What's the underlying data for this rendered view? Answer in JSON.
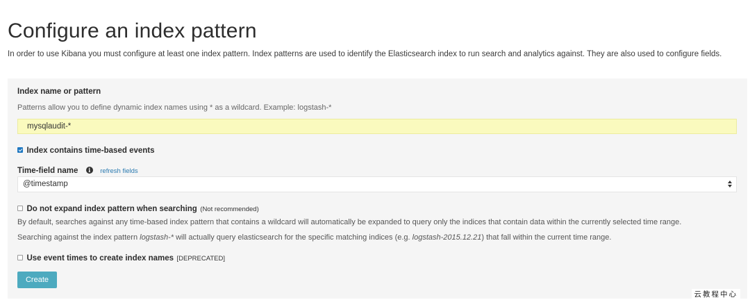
{
  "header": {
    "title": "Configure an index pattern",
    "description": "In order to use Kibana you must configure at least one index pattern. Index patterns are used to identify the Elasticsearch index to run search and analytics against. They are also used to configure fields."
  },
  "form": {
    "index_name": {
      "label": "Index name or pattern",
      "help": "Patterns allow you to define dynamic index names using * as a wildcard. Example: logstash-*",
      "value": "mysqlaudit-*"
    },
    "time_based": {
      "label": "Index contains time-based events",
      "checked": true
    },
    "time_field": {
      "label": "Time-field name",
      "info_icon": "info-icon",
      "refresh_link": "refresh fields",
      "selected": "@timestamp"
    },
    "no_expand": {
      "label": "Do not expand index pattern when searching",
      "note": "(Not recommended)",
      "checked": false,
      "para1": "By default, searches against any time-based index pattern that contains a wildcard will automatically be expanded to query only the indices that contain data within the currently selected time range.",
      "para2_a": "Searching against the index pattern ",
      "para2_pattern": "logstash-*",
      "para2_b": " will actually query elasticsearch for the specific matching indices (e.g. ",
      "para2_example": "logstash-2015.12.21",
      "para2_c": ") that fall within the current time range."
    },
    "event_times": {
      "label": "Use event times to create index names",
      "note": "[DEPRECATED]",
      "checked": false
    },
    "create_label": "Create"
  },
  "watermark": "云教程中心",
  "colors": {
    "panel_bg": "#f5f5f5",
    "input_highlight": "#fafabe",
    "button": "#4daabf",
    "link": "#2a7ab0",
    "checkbox_checked": "#1f78c1"
  }
}
